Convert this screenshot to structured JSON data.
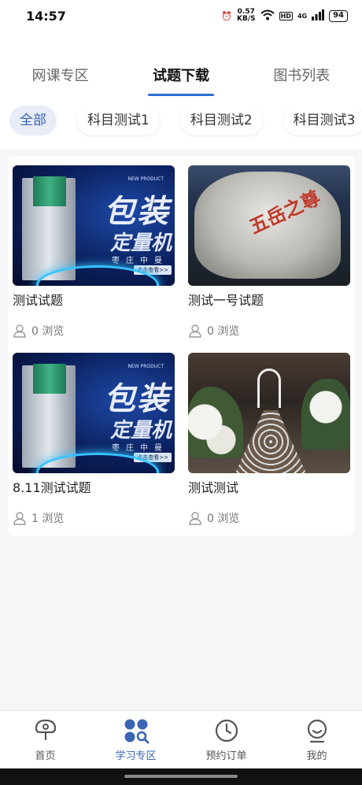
{
  "status_bar": {
    "time": "14:57",
    "net_speed": "0.57",
    "net_unit": "KB/S",
    "hd": "HD",
    "signal": "4G",
    "battery": "94"
  },
  "tabs": [
    {
      "label": "网课专区",
      "active": false
    },
    {
      "label": "试题下载",
      "active": true
    },
    {
      "label": "图书列表",
      "active": false
    }
  ],
  "chips": [
    {
      "label": "全部",
      "active": true
    },
    {
      "label": "科目测试1",
      "active": false
    },
    {
      "label": "科目测试2",
      "active": false
    },
    {
      "label": "科目测试3",
      "active": false
    }
  ],
  "items": [
    {
      "title": "测试试题",
      "views": "0 浏览",
      "image": "packaging-machine-ad",
      "art": {
        "big1": "包装",
        "big2": "定量机",
        "np": "NEW PRODUCT",
        "city": "枣庄中曼",
        "btn": "点击查看>>"
      }
    },
    {
      "title": "测试一号试题",
      "views": "0 浏览",
      "image": "rock-inscription-photo",
      "art": {
        "txt": "五岳之尊"
      }
    },
    {
      "title": "8.11测试试题",
      "views": "1 浏览",
      "image": "packaging-machine-ad",
      "art": {
        "big1": "包装",
        "big2": "定量机",
        "np": "NEW PRODUCT",
        "city": "枣庄中曼",
        "btn": "点击查看>>"
      }
    },
    {
      "title": "测试测试",
      "views": "0 浏览",
      "image": "flower-garden-photo"
    }
  ],
  "bottom_nav": [
    {
      "label": "首页",
      "icon": "home-icon",
      "active": false
    },
    {
      "label": "学习专区",
      "icon": "study-icon",
      "active": true
    },
    {
      "label": "预约订单",
      "icon": "clock-icon",
      "active": false
    },
    {
      "label": "我的",
      "icon": "profile-icon",
      "active": false
    }
  ],
  "colors": {
    "accent": "#3a64b4",
    "tab_underline": "#2d6fd1",
    "chip_active_bg": "#e7ecf7"
  }
}
